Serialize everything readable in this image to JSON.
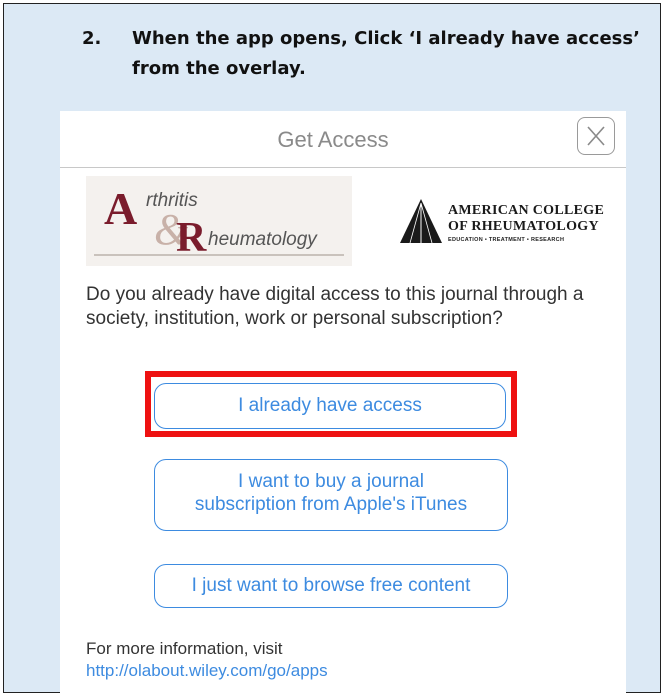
{
  "instruction": {
    "number": "2.",
    "text": "When the app opens, Click ‘I already have access’ from the overlay."
  },
  "dialog": {
    "title": "Get Access",
    "close_label": "X"
  },
  "logos": {
    "journal": {
      "a": "A",
      "rthritis": "rthritis",
      "amp": "&",
      "r": "R",
      "heumatology": "heumatology"
    },
    "college": {
      "line1": "AMERICAN COLLEGE",
      "line2": "OF RHEUMATOLOGY",
      "line3": "EDUCATION • TREATMENT • RESEARCH"
    }
  },
  "question": "Do you already have digital access to this journal through a society, institution, work or personal subscription?",
  "buttons": {
    "access": "I already have access",
    "buy_line1": "I want to buy a journal",
    "buy_line2": "subscription from Apple's iTunes",
    "browse": "I just want to browse free content"
  },
  "footer": {
    "more_info": "For more information, visit",
    "link": "http://olabout.wiley.com/go/apps"
  },
  "colors": {
    "accent_blue": "#3d8be0",
    "highlight_red": "#ee1111",
    "page_bg": "#dce9f5",
    "journal_maroon": "#7a1c2c"
  }
}
